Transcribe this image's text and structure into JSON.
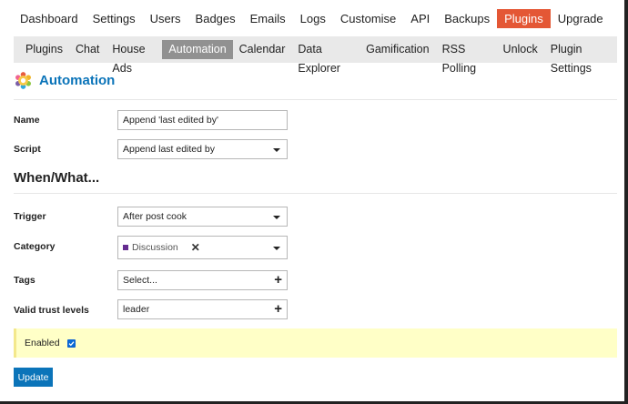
{
  "top_nav": {
    "items": [
      "Dashboard",
      "Settings",
      "Users",
      "Badges",
      "Emails",
      "Logs",
      "Customise",
      "API",
      "Backups",
      "Plugins",
      "Upgrade"
    ],
    "active": "Plugins"
  },
  "sub_nav": {
    "items": [
      "Plugins",
      "Chat",
      "House Ads",
      "Automation",
      "Calendar",
      "Data Explorer",
      "Gamification",
      "RSS Polling",
      "Unlock",
      "Plugin Settings"
    ],
    "active": "Automation"
  },
  "page": {
    "title": "Automation",
    "title_icon": "gear-icon"
  },
  "form": {
    "name": {
      "label": "Name",
      "value": "Append 'last edited by'"
    },
    "script": {
      "label": "Script",
      "value": "Append last edited by"
    },
    "section_heading": "When/What...",
    "trigger": {
      "label": "Trigger",
      "value": "After post cook"
    },
    "category": {
      "label": "Category",
      "chip": "Discussion",
      "chip_color": "#652d90"
    },
    "tags": {
      "label": "Tags",
      "placeholder": "Select..."
    },
    "trust_levels": {
      "label": "Valid trust levels",
      "value": "leader"
    },
    "enabled": {
      "label": "Enabled",
      "checked": true
    },
    "update_button": "Update"
  },
  "colors": {
    "active_top": "#e45735",
    "active_sub": "#919191",
    "accent": "#0b74b9",
    "notice_bg": "#ffffc7"
  }
}
